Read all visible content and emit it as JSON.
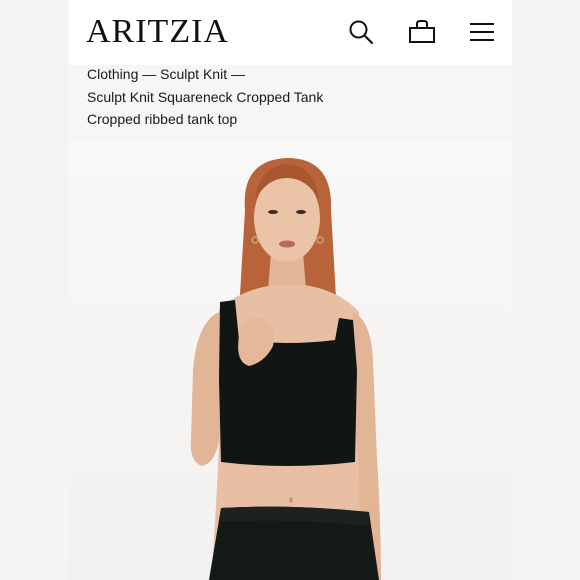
{
  "header": {
    "logo": "ARITZIA",
    "search_icon": "search-icon",
    "bag_icon": "shopping-bag-icon",
    "menu_icon": "hamburger-menu-icon"
  },
  "breadcrumb": {
    "items": [
      "Clothing",
      "Sculpt Knit"
    ],
    "separator": "—",
    "product_title": "Sculpt Knit Squareneck Cropped Tank",
    "product_subtitle": "Cropped ribbed tank top"
  },
  "product_image": {
    "description_hidden": true
  },
  "colors": {
    "background": "#f6f4f3",
    "header_bg": "#ffffff",
    "text": "#1a1a1a",
    "garment": "#111514",
    "skin": "#e8bfa2",
    "hair": "#b8633a"
  }
}
